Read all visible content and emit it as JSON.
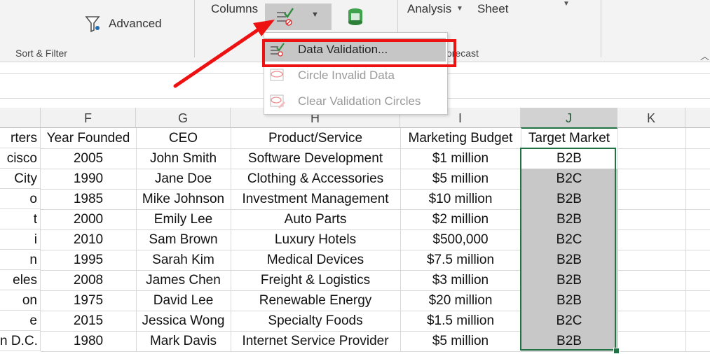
{
  "ribbon": {
    "advanced_label": "Advanced",
    "sort_filter_label": "Sort & Filter",
    "columns_label": "Columns",
    "analysis_label": "Analysis",
    "sheet_label": "Sheet",
    "forecast_label": "orecast"
  },
  "menu": {
    "items": [
      {
        "label": "Data Validation...",
        "enabled": true,
        "highlighted": true
      },
      {
        "label": "Circle Invalid Data",
        "enabled": false
      },
      {
        "label": "Clear Validation Circles",
        "enabled": false
      }
    ]
  },
  "columns": [
    "F",
    "G",
    "H",
    "I",
    "J",
    "K"
  ],
  "headers": [
    "rters",
    "Year Founded",
    "CEO",
    "Product/Service",
    "Marketing Budget",
    "Target Market"
  ],
  "rows": [
    [
      "cisco",
      "2005",
      "John Smith",
      "Software Development",
      "$1 million",
      "B2B"
    ],
    [
      " City",
      "1990",
      "Jane Doe",
      "Clothing & Accessories",
      "$5 million",
      "B2C"
    ],
    [
      "o",
      "1985",
      "Mike Johnson",
      "Investment Management",
      "$10 million",
      "B2B"
    ],
    [
      "t",
      "2000",
      "Emily Lee",
      "Auto Parts",
      "$2 million",
      "B2B"
    ],
    [
      "i",
      "2010",
      "Sam Brown",
      "Luxury Hotels",
      "$500,000",
      "B2C"
    ],
    [
      "n",
      "1995",
      "Sarah Kim",
      "Medical Devices",
      "$7.5 million",
      "B2B"
    ],
    [
      "eles",
      "2008",
      "James Chen",
      "Freight & Logistics",
      "$3 million",
      "B2B"
    ],
    [
      "on",
      "1975",
      "David Lee",
      "Renewable Energy",
      "$20 million",
      "B2B"
    ],
    [
      "e",
      "2015",
      "Jessica Wong",
      "Specialty Foods",
      "$1.5 million",
      "B2C"
    ],
    [
      "n D.C.",
      "1980",
      "Mark Davis",
      "Internet Service Provider",
      "$5 million",
      "B2B"
    ]
  ],
  "colors": {
    "accent": "#217346",
    "annotation": "#ee1111"
  }
}
